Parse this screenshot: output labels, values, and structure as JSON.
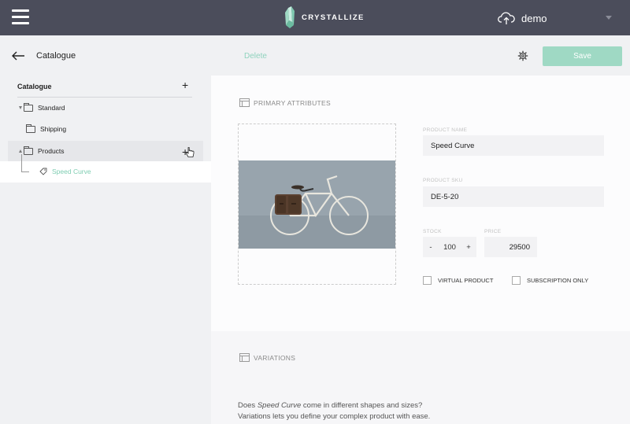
{
  "topbar": {
    "brand": "CRYSTALLIZE",
    "tenant": "demo"
  },
  "sidebar": {
    "section_title": "Catalogue",
    "tree_header": "Catalogue",
    "add_symbol": "+",
    "items": [
      {
        "label": "Standard",
        "type": "folder",
        "expanded": true
      },
      {
        "label": "Shipping",
        "type": "folder"
      },
      {
        "label": "Products",
        "type": "folder",
        "expanded": true
      },
      {
        "label": "Speed Curve",
        "type": "product",
        "selected": true
      }
    ]
  },
  "toolbar": {
    "delete_label": "Delete",
    "save_label": "Save"
  },
  "primary": {
    "heading": "PRIMARY ATTRIBUTES",
    "product_name_label": "PRODUCT NAME",
    "product_name_value": "Speed Curve",
    "sku_label": "PRODUCT SKU",
    "sku_value": "DE-5-20",
    "stock_label": "STOCK",
    "stock_value": "100",
    "stock_minus": "-",
    "stock_plus": "+",
    "price_label": "PRICE",
    "price_value": "29500",
    "virtual_label": "VIRTUAL PRODUCT",
    "subscription_label": "SUBSCRIPTION ONLY"
  },
  "variations": {
    "heading": "VARIATIONS",
    "line1_pre": "Does ",
    "line1_em": "Speed Curve",
    "line1_post": " come in different shapes and sizes?",
    "line2": "Variations lets you define your complex product with ease."
  },
  "colors": {
    "topbar": "#4b4d5b",
    "accent": "#9fd9c4",
    "accent_text": "#8fd3bd"
  }
}
